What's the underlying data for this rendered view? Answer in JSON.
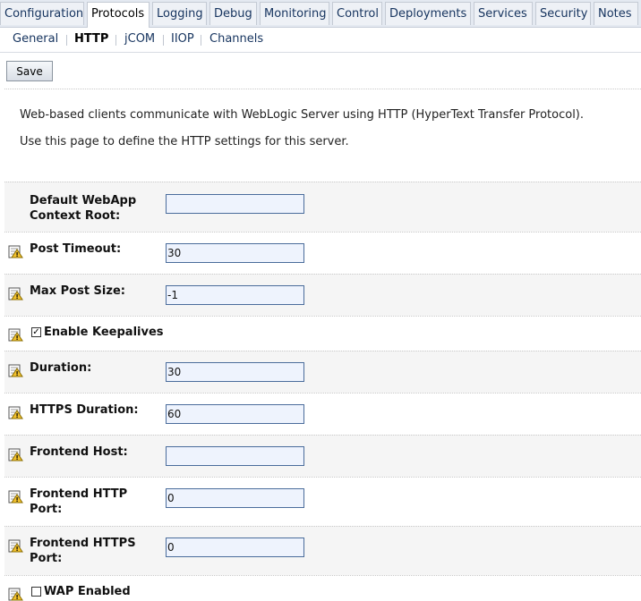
{
  "tabs": [
    "Configuration",
    "Protocols",
    "Logging",
    "Debug",
    "Monitoring",
    "Control",
    "Deployments",
    "Services",
    "Security",
    "Notes"
  ],
  "active_tab": "Protocols",
  "subtabs": [
    "General",
    "HTTP",
    "jCOM",
    "IIOP",
    "Channels"
  ],
  "active_subtab": "HTTP",
  "save_label": "Save",
  "intro": {
    "line1": "Web-based clients communicate with WebLogic Server using HTTP (HyperText Transfer Protocol).",
    "line2": "Use this page to define the HTTP settings for this server."
  },
  "fields": {
    "default_webapp": {
      "label_line1": "Default WebApp",
      "label_line2": "Context Root:",
      "value": ""
    },
    "post_timeout": {
      "label": "Post Timeout:",
      "value": "30"
    },
    "max_post_size": {
      "label": "Max Post Size:",
      "value": "-1"
    },
    "enable_keepalives": {
      "label": "Enable Keepalives",
      "checked": true,
      "mark": "✓"
    },
    "duration": {
      "label": "Duration:",
      "value": "30"
    },
    "https_duration": {
      "label": "HTTPS Duration:",
      "value": "60"
    },
    "frontend_host": {
      "label": "Frontend Host:",
      "value": ""
    },
    "frontend_http_port": {
      "label_line1": "Frontend HTTP",
      "label_line2": "Port:",
      "value": "0"
    },
    "frontend_https_port": {
      "label_line1": "Frontend HTTPS",
      "label_line2": "Port:",
      "value": "0"
    },
    "wap_enabled": {
      "label": "WAP Enabled",
      "checked": false,
      "mark": ""
    }
  },
  "icons": {
    "warning": "restart-warning-icon"
  },
  "colors": {
    "tab_bar": "#e4e9f1",
    "field_border": "#4a6c9b",
    "field_bg": "#eef3fd",
    "link": "#15335e"
  }
}
